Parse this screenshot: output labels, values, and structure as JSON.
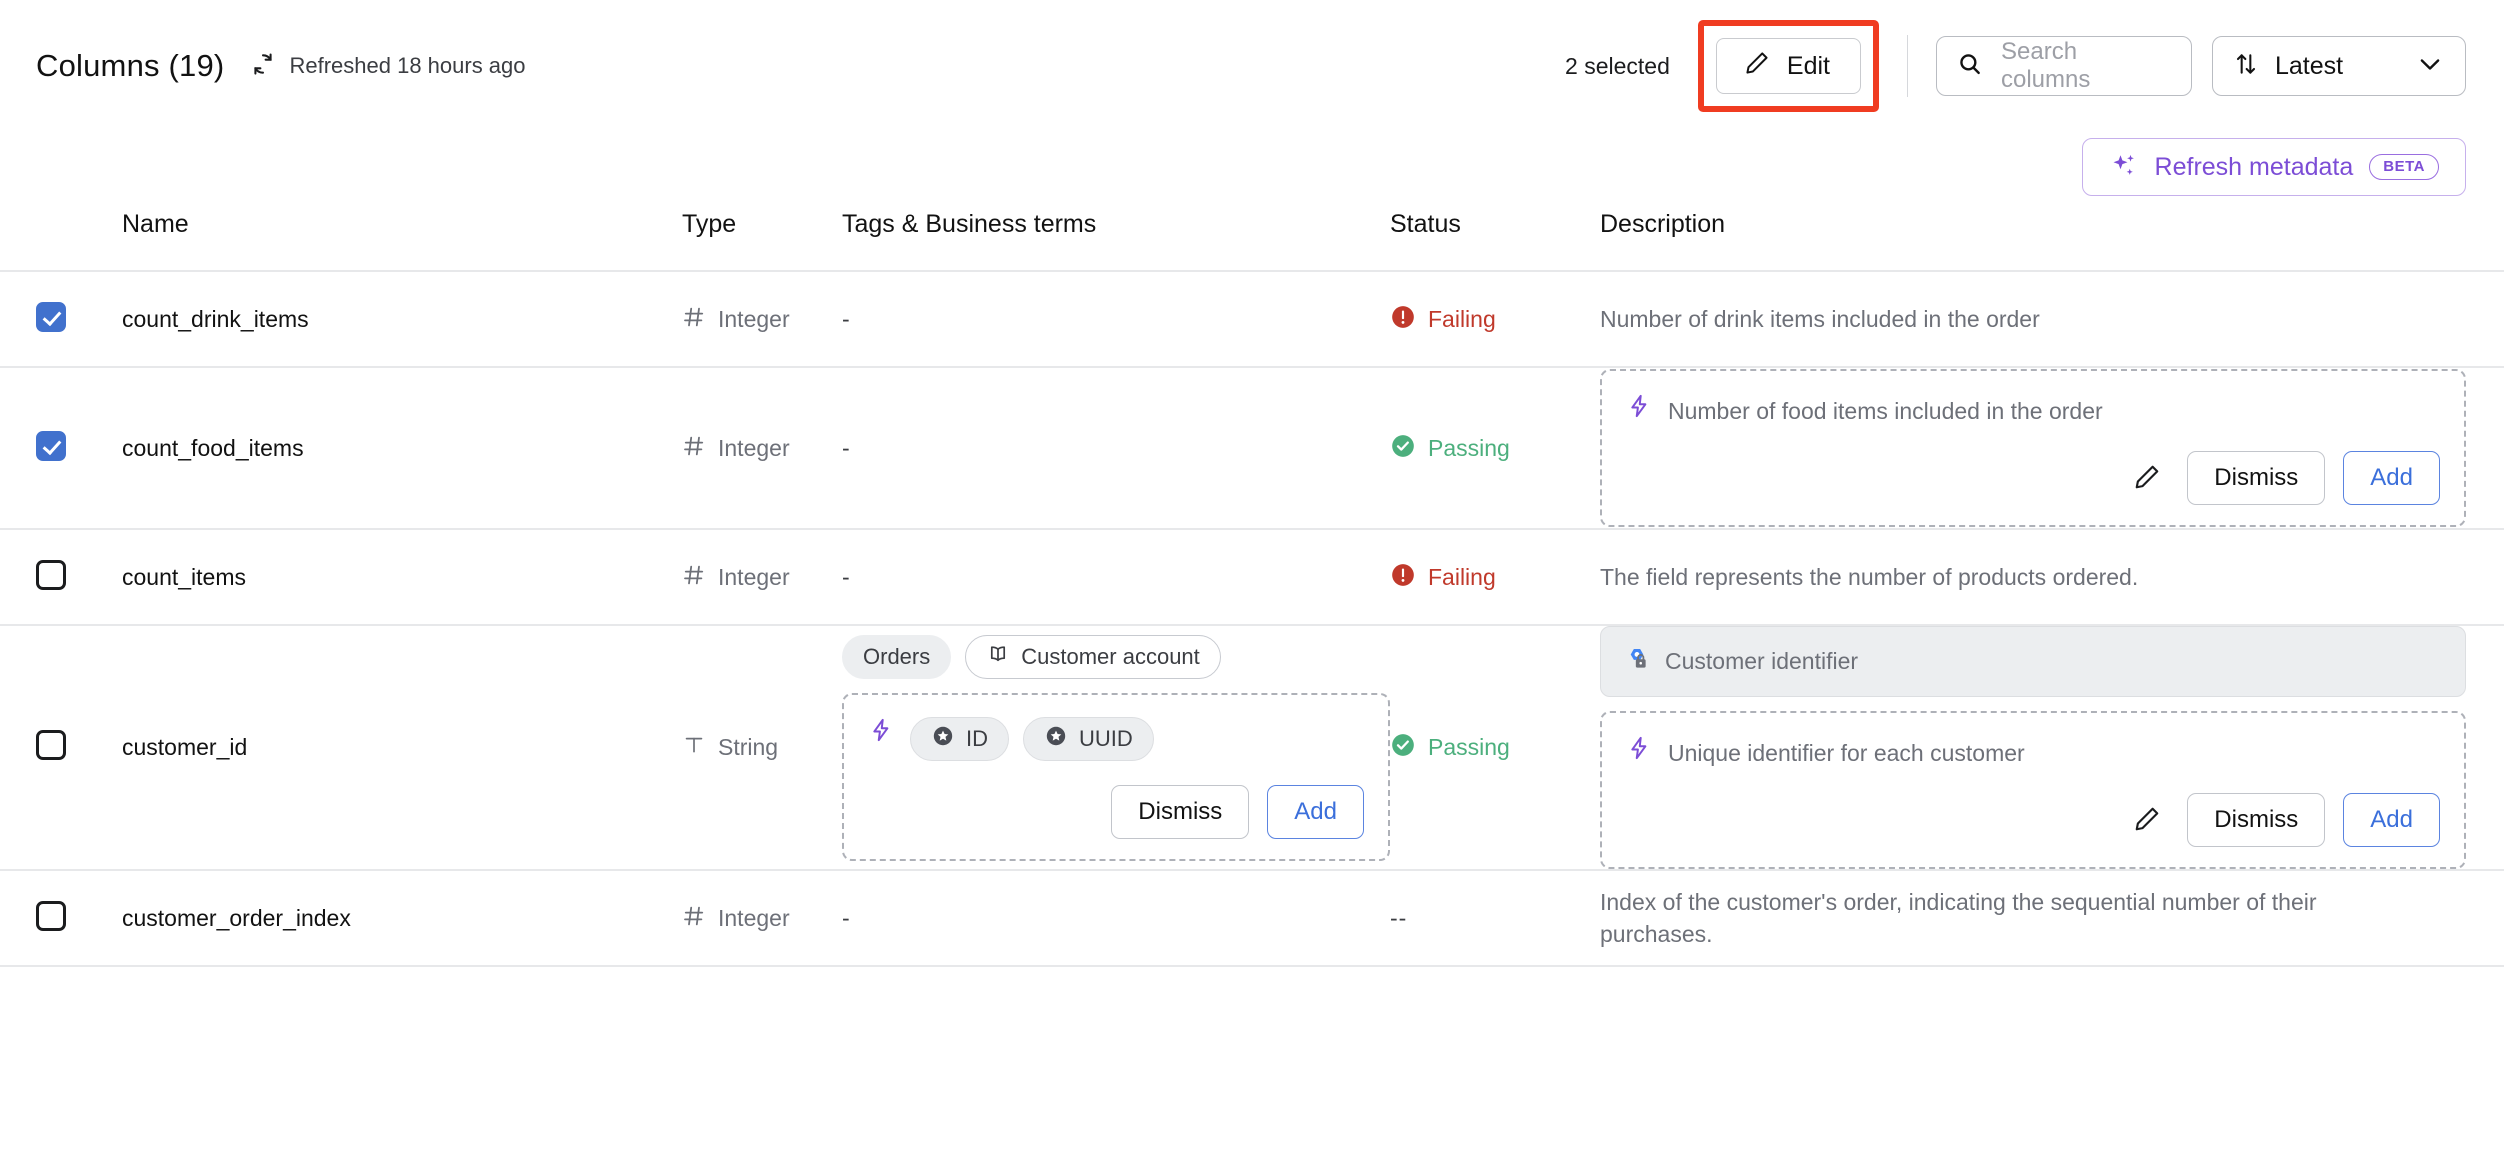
{
  "header": {
    "title": "Columns (19)",
    "refresh_icon": "refresh-circular-icon",
    "refreshed_text": "Refreshed 18 hours ago",
    "selected_count": "2 selected",
    "edit_label": "Edit",
    "edit_icon": "pencil-icon",
    "edit_highlight_color": "#f03c21",
    "search": {
      "icon": "search-icon",
      "placeholder": "Search columns",
      "value": ""
    },
    "sort": {
      "icon": "sort-arrows-icon",
      "value": "Latest",
      "chevron": "chevron-down-icon"
    },
    "refresh_metadata": {
      "icon": "sparkles-icon",
      "label": "Refresh metadata",
      "badge": "BETA",
      "color": "#7c4dd6"
    }
  },
  "table": {
    "columns": [
      "Name",
      "Type",
      "Tags & Business terms",
      "Status",
      "Description"
    ],
    "rows": [
      {
        "checked": true,
        "name": "count_drink_items",
        "type": {
          "icon": "hash-icon",
          "label": "Integer"
        },
        "tags_placeholder": "-",
        "status": {
          "state": "fail",
          "icon": "error-circle-icon",
          "label": "Failing"
        },
        "description": "Number of drink items included in the order"
      },
      {
        "checked": true,
        "name": "count_food_items",
        "type": {
          "icon": "hash-icon",
          "label": "Integer"
        },
        "tags_placeholder": "-",
        "status": {
          "state": "pass",
          "icon": "check-circle-icon",
          "label": "Passing"
        },
        "description_suggestion": {
          "icon": "lightning-bolt-icon",
          "text": "Number of food items included in the order",
          "edit_icon": "pencil-icon",
          "dismiss_label": "Dismiss",
          "add_label": "Add"
        }
      },
      {
        "checked": false,
        "name": "count_items",
        "type": {
          "icon": "hash-icon",
          "label": "Integer"
        },
        "tags_placeholder": "-",
        "status": {
          "state": "fail",
          "icon": "error-circle-icon",
          "label": "Failing"
        },
        "description": "The field represents the number of products ordered."
      },
      {
        "checked": false,
        "name": "customer_id",
        "type": {
          "icon": "text-type-icon",
          "label": "String"
        },
        "tags": [
          {
            "label": "Orders",
            "style": "filled",
            "icon": null
          },
          {
            "label": "Customer account",
            "style": "outline",
            "icon": "book-icon"
          }
        ],
        "tags_suggestion": {
          "icon": "lightning-bolt-icon",
          "chips": [
            {
              "label": "ID",
              "icon": "star-badge-icon"
            },
            {
              "label": "UUID",
              "icon": "star-badge-icon"
            }
          ],
          "dismiss_label": "Dismiss",
          "add_label": "Add"
        },
        "status": {
          "state": "pass",
          "icon": "check-circle-icon",
          "label": "Passing"
        },
        "dlp": {
          "icon": "cloud-dlp-lock-icon",
          "text": "Customer identifier"
        },
        "description_suggestion": {
          "icon": "lightning-bolt-icon",
          "text": "Unique identifier for each customer",
          "edit_icon": "pencil-icon",
          "dismiss_label": "Dismiss",
          "add_label": "Add"
        }
      },
      {
        "checked": false,
        "name": "customer_order_index",
        "type": {
          "icon": "hash-icon",
          "label": "Integer"
        },
        "tags_placeholder": "-",
        "status": {
          "state": "none",
          "icon": null,
          "label": "--"
        },
        "description": "Index of the customer's order, indicating the sequential number of their purchases."
      }
    ]
  }
}
